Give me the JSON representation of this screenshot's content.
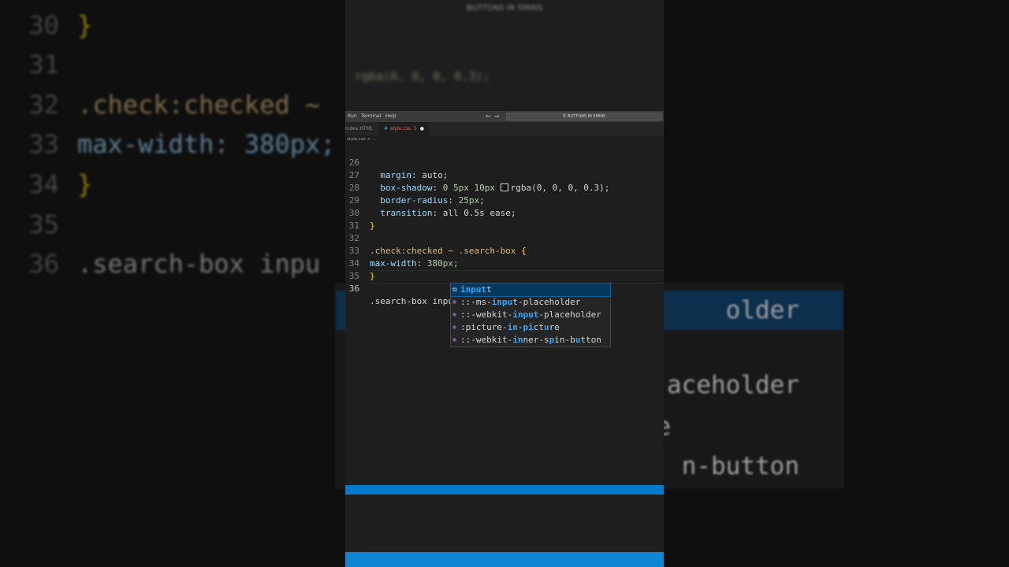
{
  "background": {
    "lines": [
      {
        "num": "30",
        "code": "}"
      },
      {
        "num": "31",
        "code": ""
      },
      {
        "num": "32",
        "code": ".check:checked ~"
      },
      {
        "num": "33",
        "code": "max-width: 380px;"
      },
      {
        "num": "34",
        "code": "}"
      },
      {
        "num": "35",
        "code": ""
      },
      {
        "num": "36",
        "code": ".search-box inpu"
      }
    ],
    "popup_fragments": [
      "older",
      "aceholder",
      "e",
      "n-button"
    ]
  },
  "header": {
    "title_blurred": "BUTTONS IN 5MINS",
    "blurred_code": "rgba(0, 0, 0, 0.3);"
  },
  "menu": {
    "items": [
      "Run",
      "Terminal",
      "Help"
    ],
    "command_center": "BUTTONS IN 5MINS"
  },
  "tabs": [
    {
      "label": "index.HTML",
      "active": false
    },
    {
      "label": "style.css",
      "badge": "1",
      "active": true
    }
  ],
  "breadcrumb": "style.css > ...",
  "editor": {
    "lines": [
      {
        "num": "26",
        "indent": "  ",
        "prop": "margin",
        "value": "auto;"
      },
      {
        "num": "27",
        "indent": "  ",
        "prop": "box-shadow",
        "value_pre": "0 5px 10px ",
        "value_post": "rgba(0, 0, 0, 0.3);"
      },
      {
        "num": "28",
        "indent": "  ",
        "prop": "border-radius",
        "value": "25px;"
      },
      {
        "num": "29",
        "indent": "  ",
        "prop": "transition",
        "value": "all 0.5s ease;"
      },
      {
        "num": "30",
        "code": "}"
      },
      {
        "num": "31",
        "code": ""
      },
      {
        "num": "32",
        "selector": ".check:checked ~ .search-box",
        "brace": "{"
      },
      {
        "num": "33",
        "prop": "max-width",
        "value": "380px;"
      },
      {
        "num": "34",
        "code": "}"
      },
      {
        "num": "35",
        "code": ""
      },
      {
        "num": "36",
        "code": ".search-box inpu"
      }
    ]
  },
  "suggestions": [
    {
      "icon": "property-icon",
      "parts": [
        [
          "input",
          true
        ],
        [
          "t",
          false
        ]
      ],
      "selected": true
    },
    {
      "icon": "value-icon",
      "parts": [
        [
          "::-ms-",
          false
        ],
        [
          "inpu",
          true
        ],
        [
          "t-placeholder",
          false
        ]
      ],
      "selected": false
    },
    {
      "icon": "value-icon",
      "parts": [
        [
          "::-webkit-",
          false
        ],
        [
          "input",
          true
        ],
        [
          "-placeholder",
          false
        ]
      ],
      "selected": false
    },
    {
      "icon": "value-icon",
      "parts": [
        [
          ":picture-",
          false
        ],
        [
          "in",
          true
        ],
        [
          "-",
          false
        ],
        [
          "pi",
          true
        ],
        [
          "ct",
          false
        ],
        [
          "u",
          true
        ],
        [
          "re",
          false
        ]
      ],
      "selected": false
    },
    {
      "icon": "value-icon",
      "parts": [
        [
          "::-webkit-",
          false
        ],
        [
          "in",
          true
        ],
        [
          "ner-s",
          false
        ],
        [
          "p",
          true
        ],
        [
          "in-b",
          false
        ],
        [
          "u",
          true
        ],
        [
          "tton",
          false
        ]
      ],
      "selected": false
    }
  ],
  "colors": {
    "accent": "#007acc",
    "selection": "#04395e",
    "match": "#2aaaff"
  }
}
